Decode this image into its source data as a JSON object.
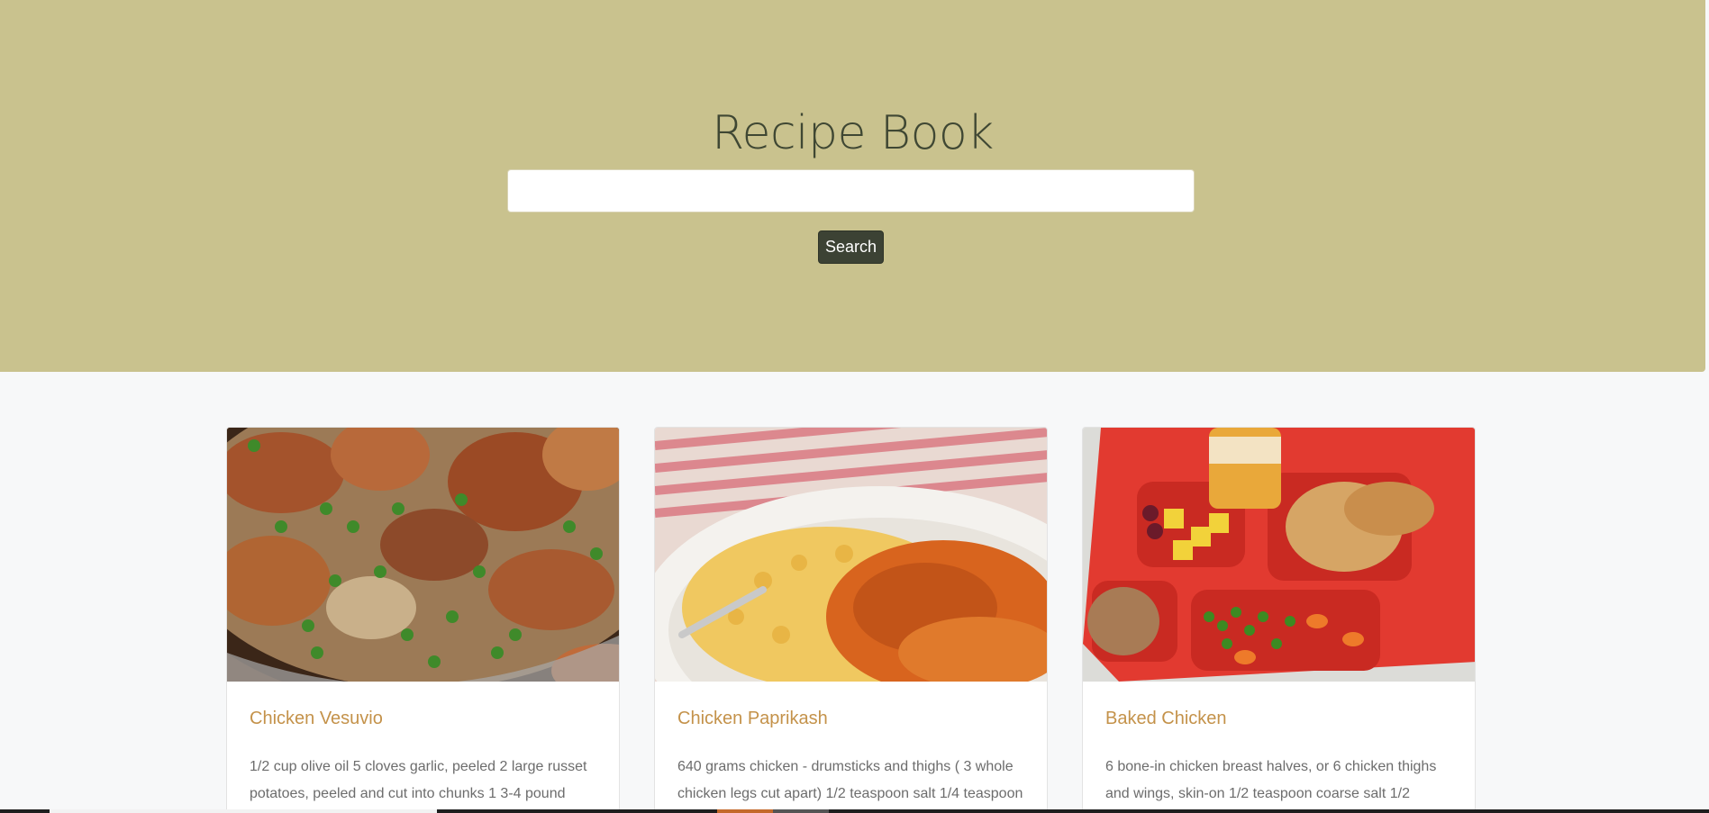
{
  "header": {
    "title": "Recipe Book",
    "search_placeholder": "",
    "search_value": "",
    "search_button_label": "Search"
  },
  "recipes": [
    {
      "title": "Chicken Vesuvio",
      "text": "1/2 cup olive oil 5 cloves garlic, peeled 2 large russet potatoes, peeled and cut into chunks 1 3-4 pound",
      "image": "chicken-vesuvio-photo"
    },
    {
      "title": "Chicken Paprikash",
      "text": "640 grams chicken - drumsticks and thighs ( 3 whole chicken legs cut apart) 1/2 teaspoon salt 1/4 teaspoon",
      "image": "chicken-paprikash-photo"
    },
    {
      "title": "Baked Chicken",
      "text": "6 bone-in chicken breast halves, or 6 chicken thighs and wings, skin-on 1/2 teaspoon coarse salt 1/2",
      "image": "baked-chicken-photo"
    }
  ],
  "colors": {
    "hero_background": "#c9c28e",
    "title_color": "#3f4733",
    "button_background": "#3c4234",
    "card_title_color": "#c4924a",
    "page_background": "#f7f8f9"
  }
}
